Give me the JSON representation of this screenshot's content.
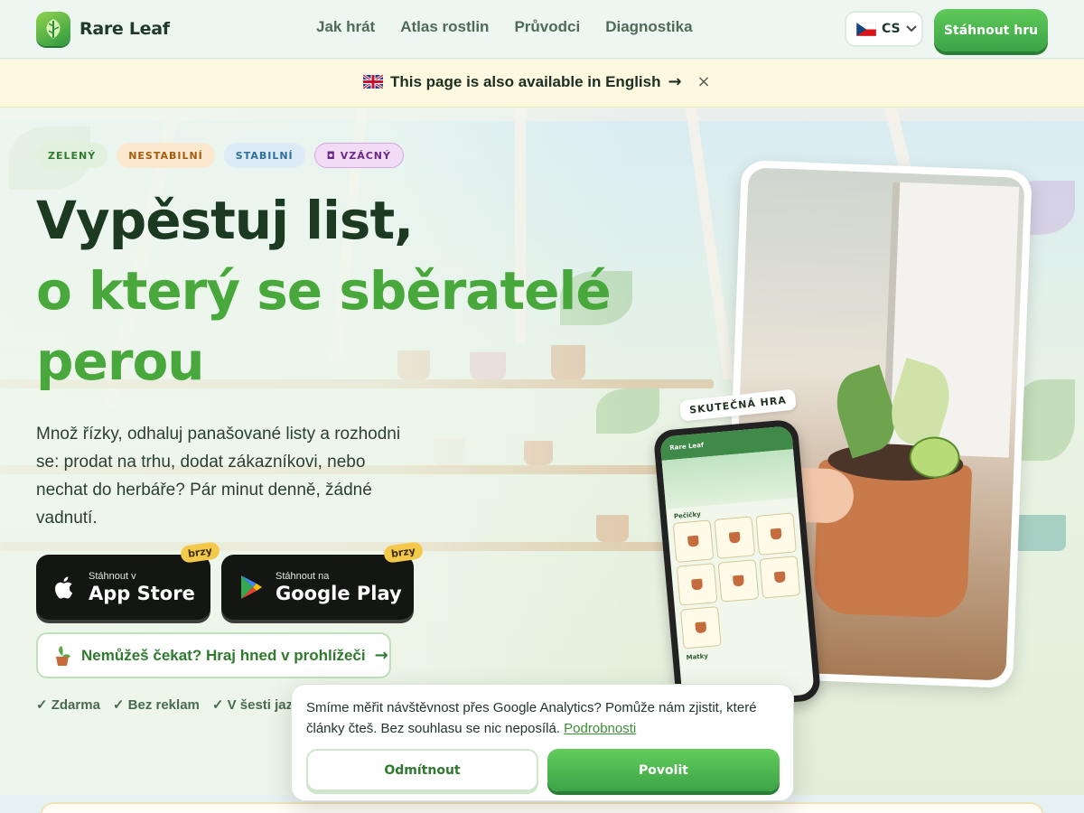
{
  "header": {
    "logo_text": "Rare Leaf",
    "nav": [
      "Jak hrát",
      "Atlas rostlin",
      "Průvodci",
      "Diagnostika"
    ],
    "language": "CS",
    "download_label": "Stáhnout hru"
  },
  "banner": {
    "text": "This page is also available in English",
    "arrow": "→",
    "close": "×"
  },
  "hero": {
    "tags": [
      {
        "label": "ZELENÝ",
        "color": "#2f7a2e",
        "bg": "#e1f1dd"
      },
      {
        "label": "NESTABILNÍ",
        "color": "#a45c10",
        "bg": "#fbe8cf"
      },
      {
        "label": "STABILNÍ",
        "color": "#2e6f99",
        "bg": "#dcebf6"
      },
      {
        "label": "◘ VZÁCNÝ",
        "color": "#6b2a87",
        "bg": "#f2dcf5"
      }
    ],
    "title_line1": "Vypěstuj list,",
    "title_line2": "o který se sběratelé",
    "title_line3": "perou",
    "lead": "Množ řízky, odhaluj panašované listy a rozhodni se: prodat na trhu, dodat zákazníkovi, nebo nechat do herbáře? Pár minut denně, žádné vadnutí.",
    "appstore_small": "Stáhnout v",
    "appstore_big": "App Store",
    "googleplay_small": "Stáhnout na",
    "googleplay_big": "Google Play",
    "soon": "brzy",
    "browser_cta": "Nemůžeš čekat? Hraj hned v prohlížeči",
    "browser_arrow": "→",
    "checks": [
      "✓ Zdarma",
      "✓ Bez reklam",
      "✓ V šesti jazy"
    ],
    "badge": "SKUTEČNÁ HRA",
    "phone_title": "Rare Leaf",
    "phone_section": "Pečičky",
    "phone_section2": "Matky"
  },
  "cookie": {
    "text": "Smíme měřit návštěvnost přes Google Analytics? Pomůže nám zjistit, které články čteš. Bez souhlasu se nic neposílá.",
    "link": "Podrobnosti",
    "reject": "Odmítnout",
    "allow": "Povolit"
  },
  "colors": {
    "accent_green": "#49a83c",
    "dark_green": "#1c3a22",
    "banner_bg": "#fdf8e0"
  }
}
